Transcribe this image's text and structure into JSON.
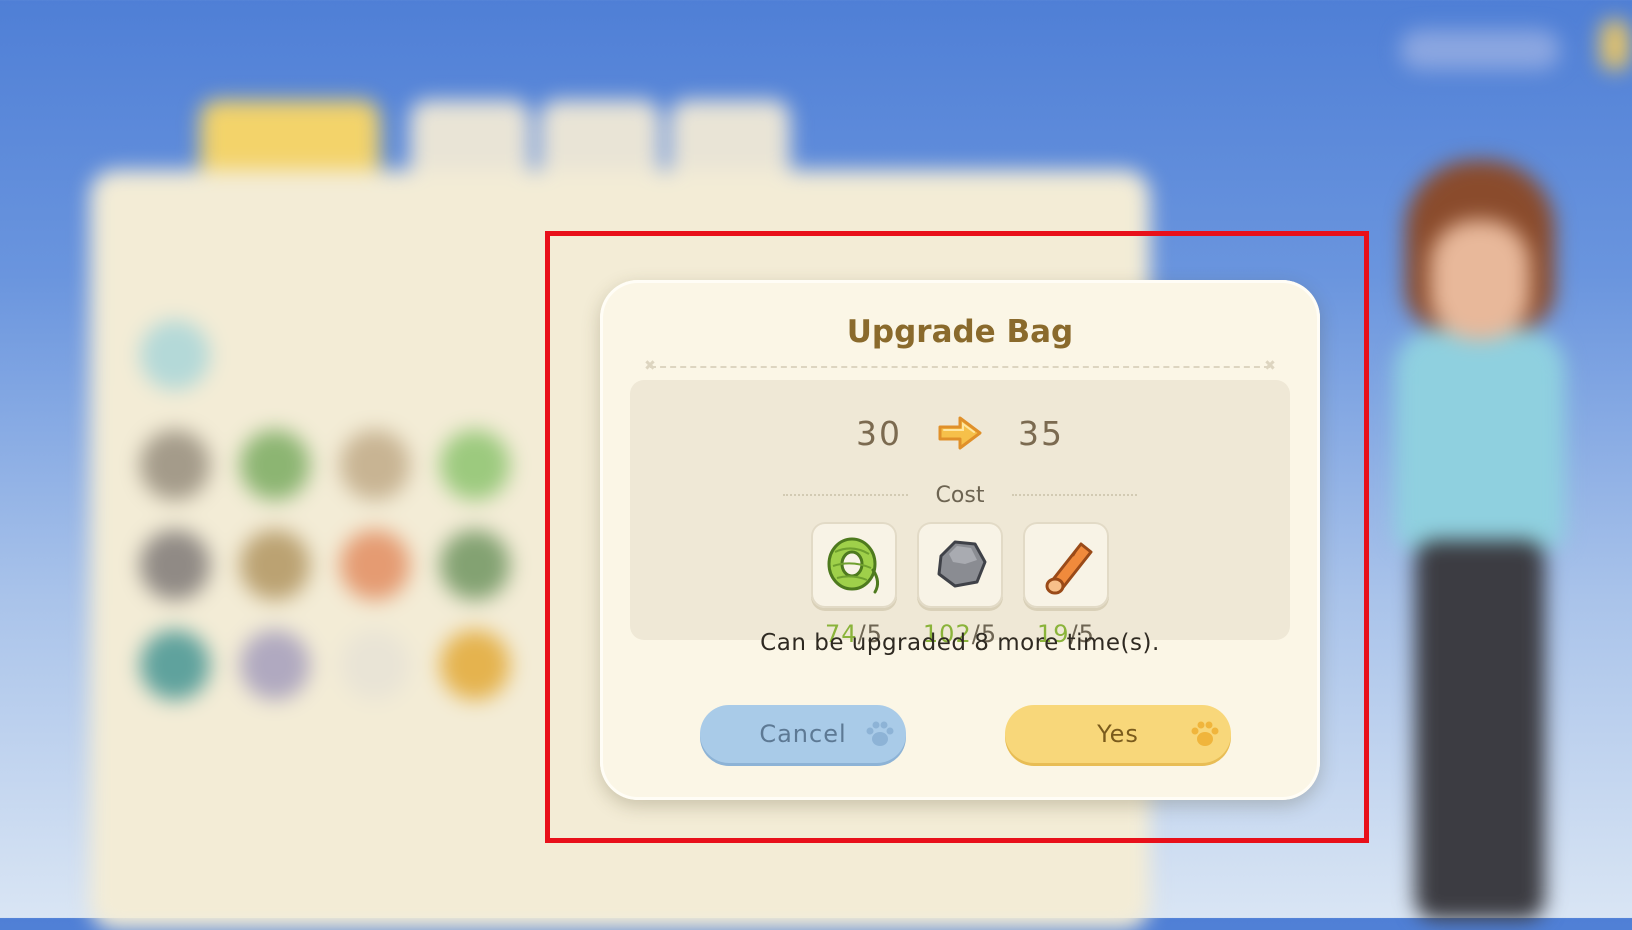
{
  "dialog": {
    "title": "Upgrade Bag",
    "capacity_from": "30",
    "capacity_to": "35",
    "cost_label": "Cost",
    "items": [
      {
        "icon": "rope-coil-icon",
        "have": "74",
        "sep": "/",
        "need": "5"
      },
      {
        "icon": "stone-icon",
        "have": "102",
        "sep": "/",
        "need": "5"
      },
      {
        "icon": "wood-log-icon",
        "have": "19",
        "sep": "/",
        "need": "5"
      }
    ],
    "note": "Can be upgraded 8 more time(s).",
    "cancel_label": "Cancel",
    "yes_label": "Yes"
  },
  "colors": {
    "have_count": "#8ab33a",
    "cancel_button": "#a9cbe8",
    "yes_button": "#f8d77a",
    "highlight_frame": "#e8101a"
  }
}
